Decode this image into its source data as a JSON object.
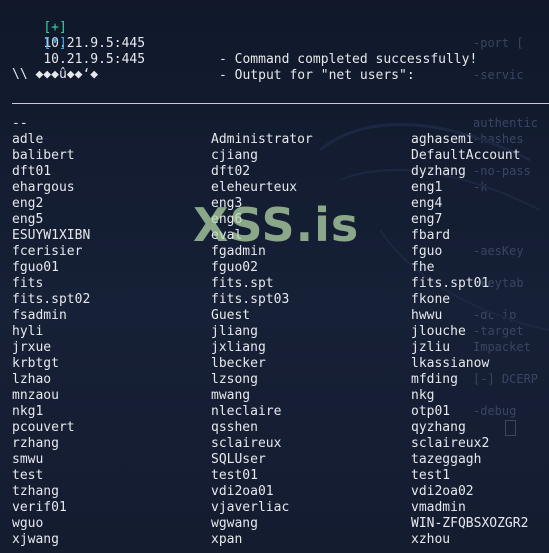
{
  "status_lines": [
    {
      "tag": "[+]",
      "host": "10.21.9.5:445",
      "message": "- Command completed successfully!"
    },
    {
      "tag": "[*]",
      "host": "10.21.9.5:445",
      "message": "- Output for \"net users\":"
    }
  ],
  "garbled_header": "\\\\ ◆◆◆û◆◆‘◆",
  "dashes": "--",
  "users": [
    [
      "adle",
      "Administrator",
      "aghasemi"
    ],
    [
      "balibert",
      "cjiang",
      "DefaultAccount"
    ],
    [
      "dft01",
      "dft02",
      "dyzhang"
    ],
    [
      "ehargous",
      "eleheurteux",
      "eng1"
    ],
    [
      "eng2",
      "eng3",
      "eng4"
    ],
    [
      "eng5",
      "eng6",
      "eng7"
    ],
    [
      "ESUYW1XIBN",
      "eval",
      "fbard"
    ],
    [
      "fcerisier",
      "fgadmin",
      "fguo"
    ],
    [
      "fguo01",
      "fguo02",
      "fhe"
    ],
    [
      "fits",
      "fits.spt",
      "fits.spt01"
    ],
    [
      "fits.spt02",
      "fits.spt03",
      "fkone"
    ],
    [
      "fsadmin",
      "Guest",
      "hwwu"
    ],
    [
      "hyli",
      "jliang",
      "jlouche"
    ],
    [
      "jrxue",
      "jxliang",
      "jzliu"
    ],
    [
      "krbtgt",
      "lbecker",
      "lkassianow"
    ],
    [
      "lzhao",
      "lzsong",
      "mfding"
    ],
    [
      "mnzaou",
      "mwang",
      "nkg"
    ],
    [
      "nkg1",
      "nleclaire",
      "otp01"
    ],
    [
      "pcouvert",
      "qsshen",
      "qyzhang"
    ],
    [
      "rzhang",
      "sclaireux",
      "sclaireux2"
    ],
    [
      "smwu",
      "SQLUser",
      "tazeggagh"
    ],
    [
      "test",
      "test01",
      "test1"
    ],
    [
      "tzhang",
      "vdi2oa01",
      "vdi2oa02"
    ],
    [
      "verif01",
      "vjaverliac",
      "vmadmin"
    ],
    [
      "wguo",
      "wgwang",
      "WIN-ZFQBSXOZGR2"
    ],
    [
      "xjwang",
      "xpan",
      "xzhou"
    ]
  ],
  "watermark": "XSS.is",
  "background_text": [
    "-port [",
    "-servic",
    "authentic",
    "-hashes",
    "-no-pass",
    "-k",
    "-aesKey",
    "-keytab",
    "-dc-ip",
    "-target",
    "Impacket",
    "[-] DCERP",
    "-debug"
  ],
  "colors": {
    "background": "#131a2b",
    "success_tag": "#3ed1a4",
    "info_tag": "#4aa8e8",
    "text": "#e6e8ec",
    "watermark": "#b8dcaa"
  }
}
